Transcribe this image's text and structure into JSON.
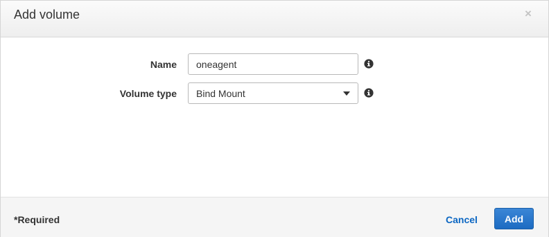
{
  "dialog": {
    "title": "Add volume",
    "close_symbol": "×"
  },
  "form": {
    "name": {
      "label": "Name",
      "value": "oneagent",
      "info_icon": "info-icon"
    },
    "volume_type": {
      "label": "Volume type",
      "selected": "Bind Mount",
      "info_icon": "info-icon"
    }
  },
  "footer": {
    "required_note": "*Required",
    "cancel_label": "Cancel",
    "add_label": "Add"
  },
  "colors": {
    "link": "#0b66c2",
    "primary_button": "#1c6bc2",
    "header_bg": "#eeeeee",
    "footer_bg": "#f5f5f5"
  }
}
